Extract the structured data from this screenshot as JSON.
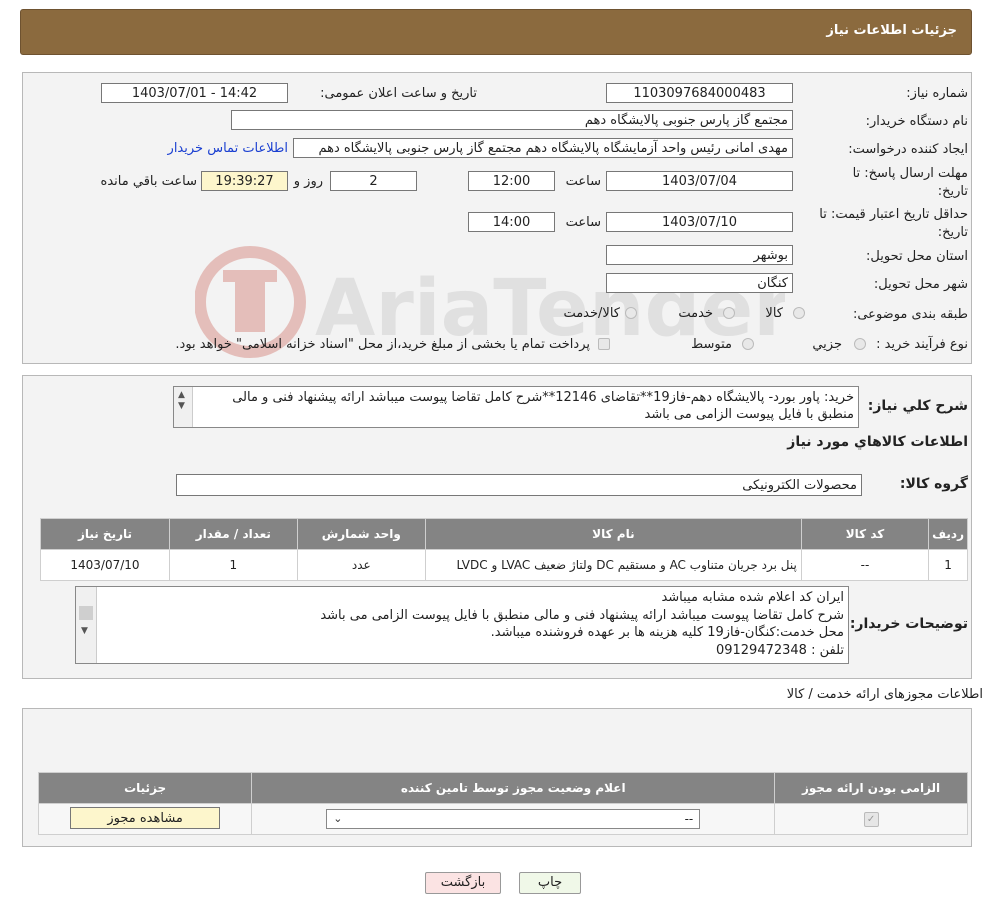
{
  "header": {
    "title": "جزئیات اطلاعات نیاز"
  },
  "form": {
    "need_number_label": "شماره نیاز:",
    "need_number": "1103097684000483",
    "announce_label": "تاریخ و ساعت اعلان عمومی:",
    "announce_value": "1403/07/01 - 14:42",
    "buyer_org_label": "نام دستگاه خریدار:",
    "buyer_org": "مجتمع گاز پارس جنوبی  پالایشگاه دهم",
    "requester_label": "ایجاد کننده درخواست:",
    "requester": "مهدی امانی رئیس واحد آزمایشگاه پالایشگاه دهم  مجتمع گاز پارس جنوبی  پالایشگاه دهم",
    "buyer_contact_link": "اطلاعات تماس خریدار",
    "deadline_label": "مهلت ارسال پاسخ: تا تاریخ:",
    "deadline_date": "1403/07/04",
    "time_label": "ساعت",
    "deadline_time": "12:00",
    "days_value": "2",
    "days_label": "روز و",
    "remaining_time": "19:39:27",
    "remaining_label": "ساعت باقي مانده",
    "validity_label": "حداقل تاریخ اعتبار قیمت: تا تاریخ:",
    "validity_date": "1403/07/10",
    "validity_time": "14:00",
    "province_label": "استان محل تحویل:",
    "province": "بوشهر",
    "city_label": "شهر محل تحویل:",
    "city": "کنگان",
    "category_label": "طبقه بندی موضوعی:",
    "category_options": [
      "کالا",
      "خدمت",
      "کالا/خدمت"
    ],
    "purchase_type_label": "نوع فرآیند خرید :",
    "purchase_options": [
      "جزیي",
      "متوسط"
    ],
    "purchase_note": "پرداخت تمام یا بخشی از مبلغ خرید،از محل \"اسناد خزانه اسلامی\" خواهد بود."
  },
  "summary": {
    "label": "شرح کلي نياز:",
    "text": "خرید: پاور بورد- پالایشگاه دهم-فاز19**تقاضای 12146**شرح کامل تقاضا پیوست میباشد ارائه پیشنهاد فنی و مالی منطبق با فایل پیوست الزامی می باشد",
    "goods_info_title": "اطلاعات کالاهاي مورد نياز",
    "group_label": "گروه کالا:",
    "group_value": "محصولات الکترونیکی"
  },
  "items_table": {
    "headers": [
      "رديف",
      "کد کالا",
      "نام کالا",
      "واحد شمارش",
      "تعداد / مقدار",
      "تاریخ نیاز"
    ],
    "rows": [
      [
        "1",
        "--",
        "پنل برد جریان متناوب AC و مستقیم DC ولتاژ ضعیف LVAC و LVDC",
        "عدد",
        "1",
        "1403/07/10"
      ]
    ]
  },
  "buyer_notes": {
    "label": "توضیحات خریدار:",
    "lines": [
      "ایران کد اعلام شده مشابه میباشد",
      "شرح کامل تقاضا پیوست میباشد ارائه پیشنهاد فنی و مالی منطبق با فایل پیوست الزامی می باشد",
      "محل خدمت:کنگان-فاز19 کلیه هزینه ها بر عهده فروشنده میباشد.",
      "تلفن : 09129472348"
    ]
  },
  "permits": {
    "title": "اطلاعات مجوزهای ارائه خدمت / کالا",
    "headers": [
      "الزامی بودن ارائه مجوز",
      "اعلام وضعیت مجوز توسط تامین کننده",
      "جزئیات"
    ],
    "select_value": "--",
    "view_button": "مشاهده مجوز"
  },
  "watermark": {
    "text": "AriaTender.neT"
  },
  "actions": {
    "print": "چاپ",
    "back": "بازگشت"
  }
}
